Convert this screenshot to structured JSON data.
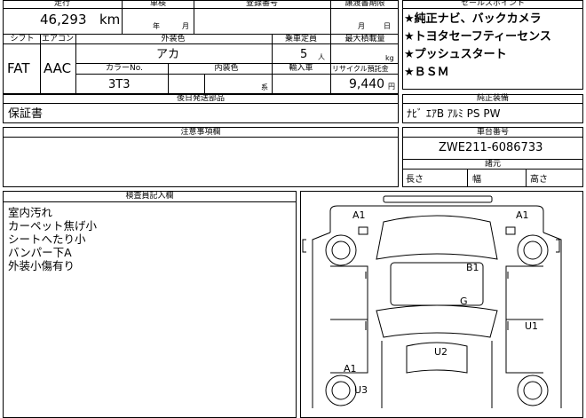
{
  "header": {
    "mileage_label": "走行",
    "shaken_label": "車検",
    "reg_label": "登録番号",
    "transfer_label": "譲渡書期限",
    "sales_label": "セールスポイント"
  },
  "mileage": {
    "value": "46,293",
    "unit": "km"
  },
  "shaken": {
    "year": "年",
    "month": "月"
  },
  "transfer": {
    "month": "月",
    "day": "日"
  },
  "row2": {
    "shift_label": "シフト",
    "ac_label": "エアコン",
    "exterior_color_label": "外装色",
    "capacity_label": "乗車定員",
    "max_load_label": "最大積載量",
    "shift": "FAT",
    "ac": "AAC",
    "exterior_color": "アカ",
    "capacity": "5",
    "capacity_unit": "人",
    "load_unit": "kg",
    "color_no_label": "カラーNo.",
    "interior_color_label": "内装色",
    "import_label": "輸入車",
    "recycle_label": "リサイクル預託金",
    "color_no": "3T3",
    "interior_unit": "系",
    "recycle_value": "9,440",
    "recycle_unit": "円"
  },
  "sales_points": [
    "★純正ナビ、バックカメラ",
    "★トヨタセーフティーセンス",
    "★プッシュスタート",
    "★ＢＳＭ"
  ],
  "later_parts": {
    "label": "後日発送部品",
    "value": "保証書"
  },
  "equipment": {
    "label": "純正装備",
    "value": "ﾅﾋﾞ ｴｱB ｱﾙﾐ PS PW"
  },
  "caution": {
    "label": "注意事項欄"
  },
  "chassis": {
    "label": "車台番号",
    "value": "ZWE211-6086733"
  },
  "dimensions": {
    "label": "諸元",
    "length": "長さ",
    "width": "幅",
    "height": "高さ"
  },
  "inspector": {
    "label": "検査員記入欄",
    "notes": [
      "室内汚れ",
      "カーペット焦げ小",
      "シートへたり小",
      "バンパー下A",
      "外装小傷有り"
    ]
  },
  "diagram_marks": [
    "A1",
    "A1",
    "B1",
    "G",
    "U1",
    "U2",
    "A1",
    "U3"
  ]
}
